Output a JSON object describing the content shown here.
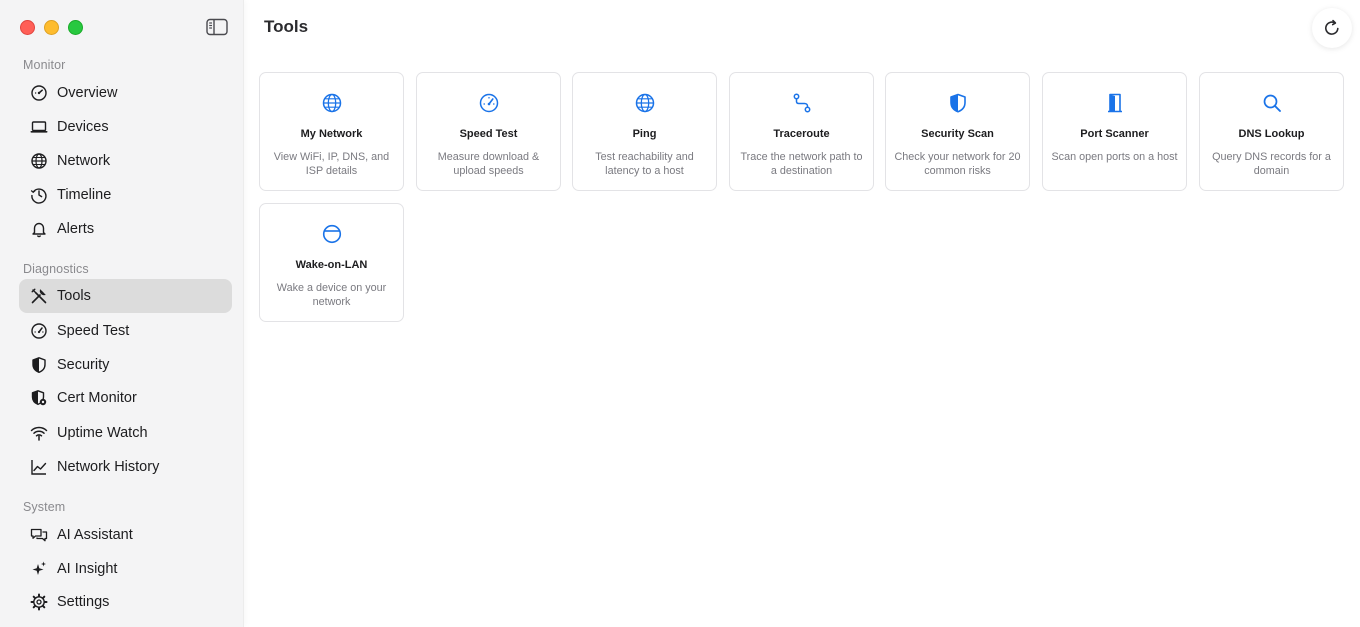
{
  "window": {
    "title": "Tools"
  },
  "sidebar": {
    "sections": {
      "monitor": "Monitor",
      "diagnostics": "Diagnostics",
      "system": "System"
    },
    "items": [
      {
        "label": "Overview",
        "icon": "gauge-icon"
      },
      {
        "label": "Devices",
        "icon": "laptop-icon"
      },
      {
        "label": "Network",
        "icon": "globe-icon"
      },
      {
        "label": "Timeline",
        "icon": "clock-history-icon"
      },
      {
        "label": "Alerts",
        "icon": "bell-icon"
      },
      {
        "label": "Tools",
        "icon": "tools-icon",
        "active": true
      },
      {
        "label": "Speed Test",
        "icon": "speedometer-icon"
      },
      {
        "label": "Security",
        "icon": "shield-icon"
      },
      {
        "label": "Cert Monitor",
        "icon": "cert-shield-icon"
      },
      {
        "label": "Uptime Watch",
        "icon": "wifi-icon"
      },
      {
        "label": "Network History",
        "icon": "line-chart-icon"
      },
      {
        "label": "AI Assistant",
        "icon": "chat-bubbles-icon"
      },
      {
        "label": "AI Insight",
        "icon": "sparkles-icon"
      },
      {
        "label": "Settings",
        "icon": "gear-icon"
      }
    ]
  },
  "tools": [
    {
      "title": "My Network",
      "desc": "View WiFi, IP, DNS, and ISP details",
      "icon": "globe-icon"
    },
    {
      "title": "Speed Test",
      "desc": "Measure download & upload speeds",
      "icon": "speedometer-icon"
    },
    {
      "title": "Ping",
      "desc": "Test reachability and latency to a host",
      "icon": "globe-icon"
    },
    {
      "title": "Traceroute",
      "desc": "Trace the network path to a destination",
      "icon": "route-icon"
    },
    {
      "title": "Security Scan",
      "desc": "Check your network for 20 common risks",
      "icon": "shield-icon"
    },
    {
      "title": "Port Scanner",
      "desc": "Scan open ports on a host",
      "icon": "door-icon"
    },
    {
      "title": "DNS Lookup",
      "desc": "Query DNS records for a domain",
      "icon": "magnifier-icon"
    },
    {
      "title": "Wake-on-LAN",
      "desc": "Wake a device on your network",
      "icon": "power-icon"
    }
  ],
  "colors": {
    "accent": "#1a73e8",
    "sidebar_bg": "#f4f4f5",
    "active_bg": "#dcdcdc"
  }
}
